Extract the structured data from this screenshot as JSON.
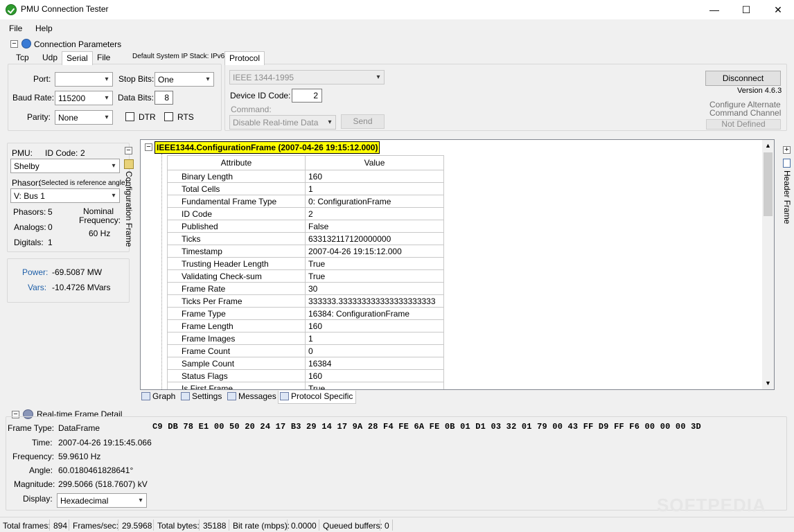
{
  "window": {
    "title": "PMU Connection Tester",
    "minimize": "—",
    "maximize": "☐",
    "close": "✕"
  },
  "menu": {
    "file": "File",
    "help": "Help"
  },
  "connection": {
    "title": "Connection Parameters",
    "tabs": [
      "Tcp",
      "Udp",
      "Serial",
      "File"
    ],
    "ip_stack": "Default System IP Stack: IPv6",
    "port_label": "Port:",
    "port_value": "",
    "baud_label": "Baud Rate:",
    "baud_value": "115200",
    "parity_label": "Parity:",
    "parity_value": "None",
    "stopbits_label": "Stop Bits:",
    "stopbits_value": "One",
    "databits_label": "Data Bits:",
    "databits_value": "8",
    "dtr_label": "DTR",
    "rts_label": "RTS"
  },
  "protocol": {
    "tab": "Protocol",
    "protocol_value": "IEEE 1344-1995",
    "device_id_label": "Device ID Code:",
    "device_id_value": "2",
    "command_label": "Command:",
    "command_value": "Disable Real-time Data",
    "send_button": "Send"
  },
  "right": {
    "disconnect_button": "Disconnect",
    "version": "Version 4.6.3",
    "alt_channel_1": "Configure Alternate",
    "alt_channel_2": "Command Channel",
    "not_defined_button": "Not Defined"
  },
  "pmu": {
    "pmu_label": "PMU:",
    "id_code_label": "ID Code:",
    "id_code_value": "2",
    "pmu_value": "Shelby",
    "phasor_label": "Phasor:",
    "phasor_note": "(Selected is reference angle)",
    "phasor_value": "V: Bus 1",
    "phasors_label": "Phasors:",
    "phasors_value": "5",
    "analogs_label": "Analogs:",
    "analogs_value": "0",
    "digitals_label": "Digitals:",
    "digitals_value": "1",
    "nominal_label_1": "Nominal",
    "nominal_label_2": "Frequency:",
    "nominal_value": "60 Hz",
    "config_frame_tab": "Configuration Frame"
  },
  "power": {
    "power_label": "Power:",
    "power_value": "-69.5087 MW",
    "vars_label": "Vars:",
    "vars_value": "-10.4726 MVars"
  },
  "tree": {
    "root": "IEEE1344.ConfigurationFrame (2007-04-26 19:15:12.000)",
    "col_attribute": "Attribute",
    "col_value": "Value",
    "rows": [
      {
        "attr": "Binary Length",
        "val": "160"
      },
      {
        "attr": "Total Cells",
        "val": "1"
      },
      {
        "attr": "Fundamental Frame Type",
        "val": "0: ConfigurationFrame"
      },
      {
        "attr": "ID Code",
        "val": "2"
      },
      {
        "attr": "Published",
        "val": "False"
      },
      {
        "attr": "Ticks",
        "val": "633132117120000000"
      },
      {
        "attr": "Timestamp",
        "val": "2007-04-26 19:15:12.000"
      },
      {
        "attr": "Trusting Header Length",
        "val": "True"
      },
      {
        "attr": "Validating Check-sum",
        "val": "True"
      },
      {
        "attr": "Frame Rate",
        "val": "30"
      },
      {
        "attr": "Ticks Per Frame",
        "val": "333333.333333333333333333333"
      },
      {
        "attr": "Frame Type",
        "val": "16384: ConfigurationFrame"
      },
      {
        "attr": "Frame Length",
        "val": "160"
      },
      {
        "attr": "Frame Images",
        "val": "1"
      },
      {
        "attr": "Frame Count",
        "val": "0"
      },
      {
        "attr": "Sample Count",
        "val": "16384"
      },
      {
        "attr": "Status Flags",
        "val": "160"
      },
      {
        "attr": "Is First Frame",
        "val": "True"
      }
    ]
  },
  "header_frame_tab": "Header Frame",
  "bottom_tabs": [
    "Graph",
    "Settings",
    "Messages",
    "Protocol Specific"
  ],
  "realtime": {
    "title": "Real-time Frame Detail",
    "frame_type_label": "Frame Type:",
    "frame_type_value": "DataFrame",
    "time_label": "Time:",
    "time_value": "2007-04-26 19:15:45.066",
    "frequency_label": "Frequency:",
    "frequency_value": "59.9610 Hz",
    "angle_label": "Angle:",
    "angle_value": "60.0180461828641°",
    "magnitude_label": "Magnitude:",
    "magnitude_value": "299.5066 (518.7607) kV",
    "display_label": "Display:",
    "display_value": "Hexadecimal",
    "hex": "C9 DB 78 E1 00 50 20 24 17 B3 29 14 17 9A 28 F4 FE 6A FE 0B 01 D1 03 32 01 79 00 43 FF D9 FF F6 00 00 00 3D"
  },
  "status": {
    "total_frames_label": "Total frames:",
    "total_frames_value": "894",
    "fps_label": "Frames/sec:",
    "fps_value": "29.5968",
    "total_bytes_label": "Total bytes:",
    "total_bytes_value": "35188",
    "bitrate_label": "Bit rate (mbps):",
    "bitrate_value": "0.0000",
    "queued_label": "Queued buffers:",
    "queued_value": "0"
  },
  "watermark": "SOFTPEDIA"
}
